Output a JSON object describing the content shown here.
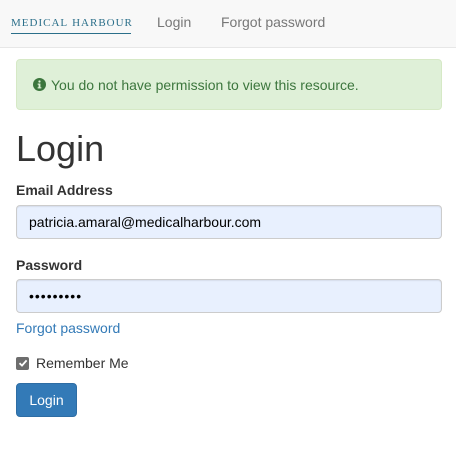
{
  "navbar": {
    "brand_part1": "MEDICAL",
    "brand_part2": "HARBOUR",
    "links": [
      {
        "label": "Login"
      },
      {
        "label": "Forgot password"
      }
    ]
  },
  "alert": {
    "icon": "info-circle-icon",
    "message": "You do not have permission to view this resource."
  },
  "page": {
    "title": "Login"
  },
  "form": {
    "email_label": "Email Address",
    "email_value": "patricia.amaral@medicalharbour.com",
    "password_label": "Password",
    "password_value": "•••••••••",
    "forgot_link": "Forgot password",
    "remember_label": "Remember Me",
    "remember_checked": true,
    "submit_label": "Login"
  },
  "colors": {
    "brand": "#2b6f8a",
    "alert_bg": "#dff0d8",
    "alert_text": "#3c763d",
    "link": "#337ab7",
    "primary_button": "#337ab7",
    "input_autofill_bg": "#e8f0fe"
  }
}
